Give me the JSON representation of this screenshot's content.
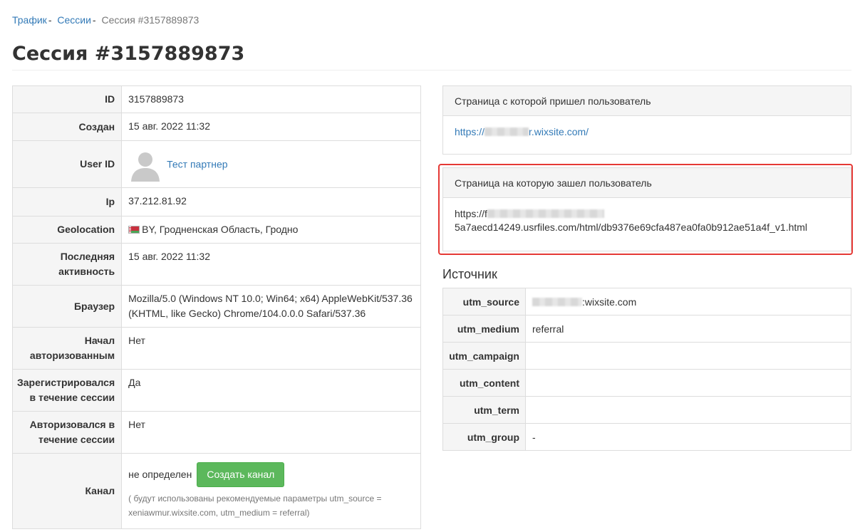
{
  "breadcrumb": {
    "items": [
      {
        "label": "Трафик"
      },
      {
        "label": "Сессии"
      }
    ],
    "separator": "-",
    "current": "Сессия #3157889873"
  },
  "page_title": "Сессия #3157889873",
  "session": {
    "rows": {
      "id": {
        "label": "ID",
        "value": "3157889873"
      },
      "created": {
        "label": "Создан",
        "value": "15 авг. 2022 11:32"
      },
      "user": {
        "label": "User ID",
        "value": "Тест партнер",
        "avatar_icon": "user-silhouette-icon"
      },
      "ip": {
        "label": "Ip",
        "value": "37.212.81.92"
      },
      "geo": {
        "label": "Geolocation",
        "value": "BY, Гродненская Область, Гродно",
        "flag_icon": "belarus-flag-icon"
      },
      "last": {
        "label": "Последняя активность",
        "value": "15 авг. 2022 11:32"
      },
      "browser": {
        "label": "Браузер",
        "value": "Mozilla/5.0 (Windows NT 10.0; Win64; x64) AppleWebKit/537.36 (KHTML, like Gecko) Chrome/104.0.0.0 Safari/537.36"
      },
      "auth_start": {
        "label": "Начал авторизованным",
        "value": "Нет"
      },
      "registered": {
        "label": "Зарегистрировался в течение сессии",
        "value": "Да"
      },
      "auth_session": {
        "label": "Авторизовался в течение сессии",
        "value": "Нет"
      },
      "channel": {
        "label": "Канал",
        "value": "не определен",
        "button": "Создать канал",
        "note": "( будут использованы рекомендуемые параметры utm_source = xeniawmur.wixsite.com, utm_medium = referral)"
      }
    }
  },
  "referrer_panel": {
    "title": "Страница с которой пришел пользователь",
    "url_prefix": "https://",
    "url_suffix": "r.wixsite.com/"
  },
  "landing_panel": {
    "title": "Страница на которую зашел пользователь",
    "url_line1": "https://f",
    "url_line2": "5a7aecd14249.usrfiles.com/html/db9376e69cfa487ea0fa0b912ae51a4f_v1.html"
  },
  "source": {
    "title": "Источник",
    "rows": [
      {
        "key": "utm_source",
        "value": ":wixsite.com"
      },
      {
        "key": "utm_medium",
        "value": "referral"
      },
      {
        "key": "utm_campaign",
        "value": ""
      },
      {
        "key": "utm_content",
        "value": ""
      },
      {
        "key": "utm_term",
        "value": ""
      },
      {
        "key": "utm_group",
        "value": "-"
      }
    ]
  },
  "colors": {
    "link": "#337ab7",
    "button_green": "#5cb85c",
    "highlight_red": "#e53935",
    "header_bg": "#f5f5f5",
    "border": "#dddddd"
  }
}
